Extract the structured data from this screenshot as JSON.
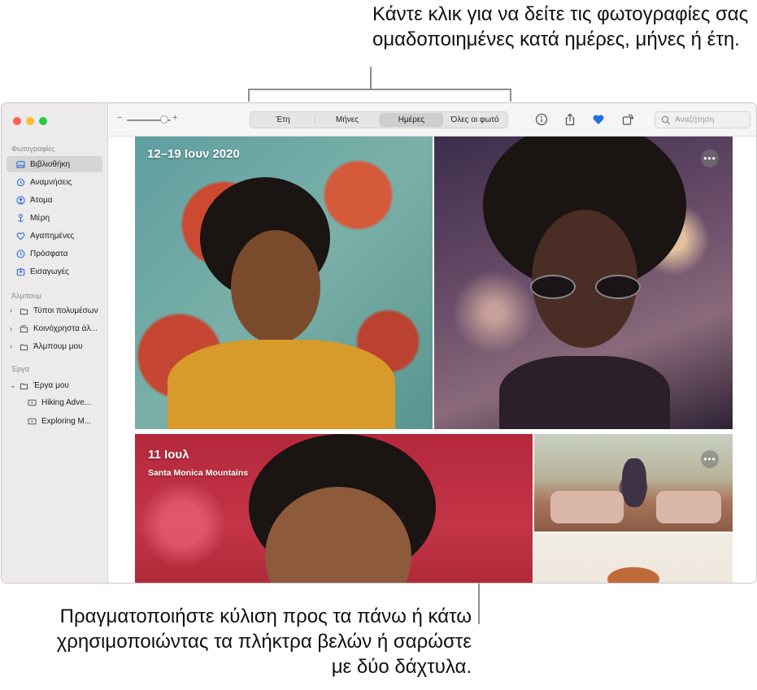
{
  "callouts": {
    "top": "Κάντε κλικ για να δείτε τις φωτογραφίες σας ομαδοποιημένες κατά ημέρες, μήνες ή έτη.",
    "bottom": "Πραγματοποιήστε κύλιση προς τα πάνω ή κάτω χρησιμοποιώντας τα πλήκτρα βελών ή σαρώστε με δύο δάχτυλα."
  },
  "sidebar": {
    "section_photos": "Φωτογραφίες",
    "photos_items": [
      {
        "label": "Βιβλιοθήκη",
        "icon": "library-icon",
        "selected": true
      },
      {
        "label": "Αναμνήσεις",
        "icon": "memories-icon"
      },
      {
        "label": "Άτομα",
        "icon": "people-icon"
      },
      {
        "label": "Μέρη",
        "icon": "places-icon"
      },
      {
        "label": "Αγαπημένες",
        "icon": "heart-icon"
      },
      {
        "label": "Πρόσφατα",
        "icon": "clock-icon"
      },
      {
        "label": "Εισαγωγές",
        "icon": "imports-icon"
      }
    ],
    "section_albums": "Άλμπουμ",
    "albums_items": [
      {
        "label": "Τύποι πολυμέσων",
        "icon": "folder-icon"
      },
      {
        "label": "Κοινόχρηστα άλ...",
        "icon": "shared-album-icon"
      },
      {
        "label": "Άλμπουμ μου",
        "icon": "folder-icon"
      }
    ],
    "section_projects": "Έργα",
    "projects_items": [
      {
        "label": "Έργα μου",
        "icon": "folder-icon"
      },
      {
        "label": "Hiking Adve...",
        "icon": "slideshow-icon"
      },
      {
        "label": "Exploring M...",
        "icon": "slideshow-icon"
      }
    ]
  },
  "toolbar": {
    "zoom_minus": "−",
    "zoom_plus": "+",
    "zoom_level": 0.85,
    "tabs": [
      {
        "label": "Έτη"
      },
      {
        "label": "Μήνες"
      },
      {
        "label": "Ημέρες",
        "active": true
      },
      {
        "label": "Όλες οι φωτό"
      }
    ],
    "search_placeholder": "Αναζήτηση"
  },
  "content": {
    "group1": {
      "title": "12–19 Ιουν 2020",
      "more": "•••"
    },
    "group2": {
      "title": "11 Ιουλ",
      "subtitle": "Santa Monica Mountains",
      "more": "•••"
    }
  },
  "colors": {
    "accent": "#2a6fdb",
    "favorite": "#1f6fe0",
    "traffic_red": "#fe5f57",
    "traffic_yellow": "#febc2e",
    "traffic_green": "#28c840"
  }
}
